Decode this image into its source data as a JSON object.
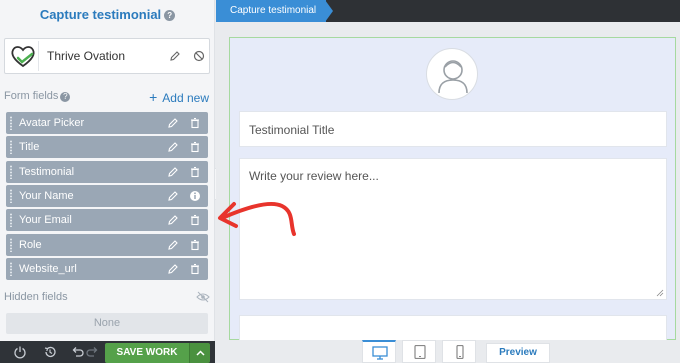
{
  "panel": {
    "title": "Capture testimonial",
    "help_icon": "question-icon",
    "template_name": "Thrive Ovation",
    "fields_label": "Form fields",
    "add_new_label": "Add new",
    "fields": [
      {
        "label": "Avatar Picker",
        "icons": [
          "edit-icon",
          "trash-icon"
        ]
      },
      {
        "label": "Title",
        "icons": [
          "edit-icon",
          "trash-icon"
        ]
      },
      {
        "label": "Testimonial",
        "icons": [
          "edit-icon",
          "trash-icon"
        ]
      },
      {
        "label": "Your Name",
        "icons": [
          "edit-icon",
          "info-icon"
        ]
      },
      {
        "label": "Your Email",
        "icons": [
          "edit-icon",
          "trash-icon"
        ]
      },
      {
        "label": "Role",
        "icons": [
          "edit-icon",
          "trash-icon"
        ]
      },
      {
        "label": "Website_url",
        "icons": [
          "edit-icon",
          "trash-icon"
        ]
      }
    ],
    "hidden_label": "Hidden fields",
    "hidden_none": "None"
  },
  "bottom": {
    "save_label": "SAVE WORK"
  },
  "canvas": {
    "breadcrumb": "Capture testimonial",
    "title_placeholder": "Testimonial Title",
    "review_placeholder": "Write your review here..."
  },
  "devices": {
    "preview_label": "Preview",
    "active": "desktop"
  },
  "colors": {
    "accent": "#2b7bbd",
    "field_row": "#9aa7b5",
    "save": "#55a14a",
    "annotation": "#e8342c"
  }
}
